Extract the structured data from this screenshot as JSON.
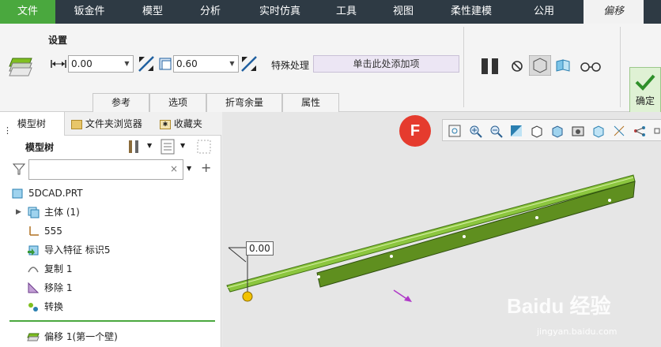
{
  "menubar": {
    "items": [
      {
        "label": "文件"
      },
      {
        "label": "钣金件"
      },
      {
        "label": "模型"
      },
      {
        "label": "分析"
      },
      {
        "label": "实时仿真"
      },
      {
        "label": "工具"
      },
      {
        "label": "视图"
      },
      {
        "label": "柔性建模"
      },
      {
        "label": "公用"
      },
      {
        "label": "偏移"
      }
    ]
  },
  "ribbon": {
    "settings_label": "设置",
    "offset_value": "0.00",
    "thickness_value": "0.60",
    "special_label": "特殊处理",
    "special_placeholder": "单击此处添加项",
    "tabs": [
      {
        "label": "参考"
      },
      {
        "label": "选项"
      },
      {
        "label": "折弯余量"
      },
      {
        "label": "属性"
      }
    ],
    "ok_label": "确定"
  },
  "panel": {
    "tabs": [
      {
        "label": "模型树"
      },
      {
        "label": "文件夹浏览器"
      },
      {
        "label": "收藏夹"
      }
    ],
    "tree_title": "模型树",
    "items": [
      {
        "label": "5DCAD.PRT"
      },
      {
        "label": "主体 (1)"
      },
      {
        "label": "555"
      },
      {
        "label": "导入特征 标识5"
      },
      {
        "label": "复制 1"
      },
      {
        "label": "移除 1"
      },
      {
        "label": "转换"
      },
      {
        "label": "偏移 1(第一个壁)"
      }
    ]
  },
  "viewport": {
    "dimension": "0.00",
    "badge": "F"
  },
  "watermark": {
    "brand": "Baidu 经验",
    "url": "jingyan.baidu.com"
  },
  "colors": {
    "menubar": "#2e3a44",
    "file_tab": "#4aa83e",
    "part_green": "#7fbf1f",
    "badge_red": "#e53b2e"
  }
}
